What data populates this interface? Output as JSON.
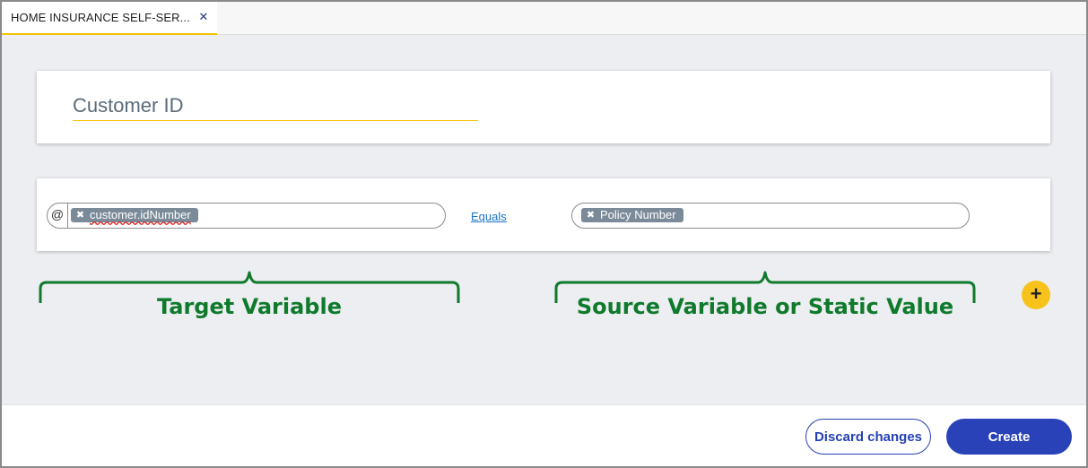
{
  "tabs": [
    {
      "label": "HOME INSURANCE SELF-SER..."
    }
  ],
  "icons": {
    "tab_close": "close-icon",
    "chip_remove": "remove-chip-icon",
    "add": "plus-icon"
  },
  "title_field": {
    "value": "Customer ID"
  },
  "condition": {
    "target_prefix": "@",
    "target_chip": "customer.idNumber",
    "operator": "Equals",
    "source_chip": "Policy Number"
  },
  "annotations": {
    "target_label": "Target Variable",
    "source_label": "Source Variable or Static Value"
  },
  "footer": {
    "discard_label": "Discard changes",
    "create_label": "Create"
  },
  "colors": {
    "accent_yellow": "#f2c200",
    "primary_blue": "#2a42b8",
    "annotation_green": "#107a2c",
    "chip_gray": "#7a8a99",
    "link_blue": "#1a73c8"
  }
}
